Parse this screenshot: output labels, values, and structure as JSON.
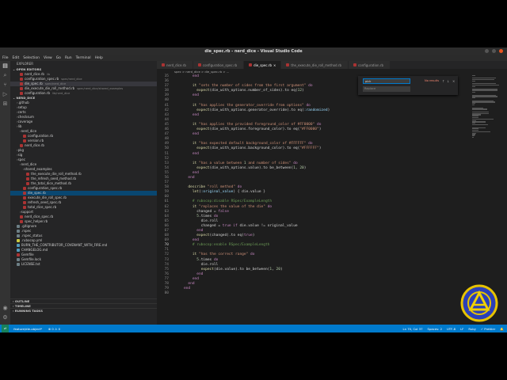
{
  "window": {
    "title": "die_spec.rb - nerd_dice - Visual Studio Code"
  },
  "menu": [
    "File",
    "Edit",
    "Selection",
    "View",
    "Go",
    "Run",
    "Terminal",
    "Help"
  ],
  "sidebar": {
    "title": "EXPLORER",
    "open_editors_header": "OPEN EDITORS",
    "open_editors": [
      {
        "name": "nerd_dice.rb",
        "desc": "lib"
      },
      {
        "name": "configuration_spec.rb",
        "desc": "spec/nerd_dice"
      },
      {
        "name": "die_spec.rb",
        "desc": "spec/nerd_dice"
      },
      {
        "name": "die_execute_die_roll_method.rb",
        "desc": "spec/nerd_dice/shared_examples"
      },
      {
        "name": "configuration.rb",
        "desc": "lib/nerd_dice"
      }
    ],
    "project_header": "NERD_DICE",
    "tree": [
      {
        "name": ".github",
        "type": "folder",
        "depth": 1
      },
      {
        "name": "setup",
        "type": "folder",
        "depth": 1
      },
      {
        "name": "certs",
        "type": "folder",
        "depth": 1
      },
      {
        "name": "checksum",
        "type": "folder",
        "depth": 1
      },
      {
        "name": "coverage",
        "type": "folder",
        "depth": 1
      },
      {
        "name": "lib",
        "type": "folder",
        "depth": 1
      },
      {
        "name": "nerd_dice",
        "type": "folder",
        "depth": 2
      },
      {
        "name": "configuration.rb",
        "type": "rb",
        "depth": 3
      },
      {
        "name": "version.rb",
        "type": "rb",
        "depth": 3
      },
      {
        "name": "nerd_dice.rb",
        "type": "rb",
        "depth": 2
      },
      {
        "name": "pkg",
        "type": "folder",
        "depth": 1
      },
      {
        "name": "sig",
        "type": "folder",
        "depth": 1
      },
      {
        "name": "spec",
        "type": "folder",
        "depth": 1
      },
      {
        "name": "nerd_dice",
        "type": "folder",
        "depth": 2
      },
      {
        "name": "shared_examples",
        "type": "folder",
        "depth": 3
      },
      {
        "name": "the_execute_die_roll_method.rb",
        "type": "rb",
        "depth": 4
      },
      {
        "name": "the_refresh_seed_method.rb",
        "type": "rb",
        "depth": 4
      },
      {
        "name": "the_total_dice_method.rb",
        "type": "rb",
        "depth": 4
      },
      {
        "name": "configuration_spec.rb",
        "type": "rb",
        "depth": 3
      },
      {
        "name": "die_spec.rb",
        "type": "rb",
        "depth": 3
      },
      {
        "name": "execute_die_roll_spec.rb",
        "type": "rb",
        "depth": 3
      },
      {
        "name": "refresh_seed_spec.rb",
        "type": "rb",
        "depth": 3
      },
      {
        "name": "total_dice_spec.rb",
        "type": "rb",
        "depth": 3
      },
      {
        "name": "support",
        "type": "folder",
        "depth": 2
      },
      {
        "name": "nerd_dice_spec.rb",
        "type": "rb",
        "depth": 2
      },
      {
        "name": "spec_helper.rb",
        "type": "rb",
        "depth": 2
      },
      {
        "name": ".gitignore",
        "type": "file",
        "depth": 1
      },
      {
        "name": ".rspec",
        "type": "file",
        "depth": 1
      },
      {
        "name": ".rspec_status",
        "type": "file",
        "depth": 1
      },
      {
        "name": ".rubocop.yml",
        "type": "yml",
        "depth": 1
      },
      {
        "name": "BURN_THE_CONTRIBUTOR_COVENANT_WITH_FIRE.md",
        "type": "md",
        "depth": 1
      },
      {
        "name": "CHANGELOG.md",
        "type": "md",
        "depth": 1
      },
      {
        "name": "Gemfile",
        "type": "rb",
        "depth": 1
      },
      {
        "name": "Gemfile.lock",
        "type": "file",
        "depth": 1
      },
      {
        "name": "LICENSE.txt",
        "type": "file",
        "depth": 1
      }
    ],
    "outline_header": "OUTLINE",
    "timeline_header": "TIMELINE",
    "tasks_header": "RUNNING TASKS"
  },
  "tabs": [
    {
      "label": "nerd_dice.rb",
      "active": false
    },
    {
      "label": "configuration_spec.rb",
      "active": false
    },
    {
      "label": "die_spec.rb",
      "active": true
    },
    {
      "label": "the_execute_die_roll_method.rb",
      "active": false
    },
    {
      "label": "configuration.rb",
      "active": false
    }
  ],
  "breadcrumb": "spec > nerd_dice > die_spec.rb > ...",
  "find": {
    "value": "pick",
    "replace_placeholder": "Replace",
    "result": "No results"
  },
  "code": [
    {
      "n": "35",
      "t": "    end"
    },
    {
      "n": "36",
      "t": ""
    },
    {
      "n": "37",
      "t": "    it \"sets the number of sides from the first argument\" do"
    },
    {
      "n": "38",
      "t": "      expect(die_with_options.number_of_sides).to eq(12)"
    },
    {
      "n": "39",
      "t": "    end"
    },
    {
      "n": "40",
      "t": ""
    },
    {
      "n": "41",
      "t": "    it \"has applies the generator_override from options\" do"
    },
    {
      "n": "42",
      "t": "      expect(die_with_options.generator_override).to eq(:randomized)"
    },
    {
      "n": "43",
      "t": "    end"
    },
    {
      "n": "44",
      "t": ""
    },
    {
      "n": "45",
      "t": "    it \"has applies the provided foreground_color of #FF0000\" do"
    },
    {
      "n": "46",
      "t": "      expect(die_with_options.foreground_color).to eq(\"#FF0000\")"
    },
    {
      "n": "47",
      "t": "    end"
    },
    {
      "n": "48",
      "t": ""
    },
    {
      "n": "49",
      "t": "    it \"has expected default background_color of #FFFFFF\" do"
    },
    {
      "n": "50",
      "t": "      expect(die_with_options.background_color).to eq(\"#FFFFFF\")"
    },
    {
      "n": "51",
      "t": "    end"
    },
    {
      "n": "52",
      "t": ""
    },
    {
      "n": "53",
      "t": "    it \"has a value between 1 and number of sides\" do"
    },
    {
      "n": "54",
      "t": "      expect(die_with_options.value).to be_between(1, 20)"
    },
    {
      "n": "55",
      "t": "    end"
    },
    {
      "n": "56",
      "t": "  end"
    },
    {
      "n": "57",
      "t": ""
    },
    {
      "n": "58",
      "t": "  describe \"roll method\" do"
    },
    {
      "n": "59",
      "t": "    let(:original_value) { die.value }"
    },
    {
      "n": "60",
      "t": ""
    },
    {
      "n": "61",
      "t": "    # rubocop:disable RSpec/ExampleLength"
    },
    {
      "n": "62",
      "t": "    it \"replaces the value of the die\" do"
    },
    {
      "n": "63",
      "t": "      changed = false"
    },
    {
      "n": "64",
      "t": "      5.times do"
    },
    {
      "n": "65",
      "t": "        die.roll"
    },
    {
      "n": "66",
      "t": "        changed = true if die.value != original_value"
    },
    {
      "n": "67",
      "t": "      end"
    },
    {
      "n": "68",
      "t": "      expect(changed).to eq(true)"
    },
    {
      "n": "69",
      "t": "    end"
    },
    {
      "n": "70",
      "t": "    # rubocop:enable RSpec/ExampleLength"
    },
    {
      "n": "71",
      "t": ""
    },
    {
      "n": "72",
      "t": "    it \"has the correct range\" do"
    },
    {
      "n": "73",
      "t": "      5.times do"
    },
    {
      "n": "74",
      "t": "        die.roll"
    },
    {
      "n": "75",
      "t": "        expect(die.value).to be_between(1, 20)"
    },
    {
      "n": "76",
      "t": "      end"
    },
    {
      "n": "77",
      "t": "    end"
    },
    {
      "n": "78",
      "t": "  end"
    },
    {
      "n": "79",
      "t": "end"
    },
    {
      "n": "80",
      "t": ""
    }
  ],
  "status": {
    "branch": "feature/die-object*",
    "errors": "⊗ 0 ⚠ 0",
    "position": "Ln 70, Col 37",
    "spaces": "Spaces: 2",
    "encoding": "UTF-8",
    "eol": "LF",
    "language": "Ruby",
    "prettier": "✓ Prettier"
  },
  "colors": {
    "accent": "#007acc",
    "string": "#ce9178",
    "keyword": "#c586c0",
    "comment": "#6a9955",
    "function": "#dcdcaa",
    "number": "#b5cea8",
    "symbol": "#9cdcfe"
  },
  "current_line": "70"
}
